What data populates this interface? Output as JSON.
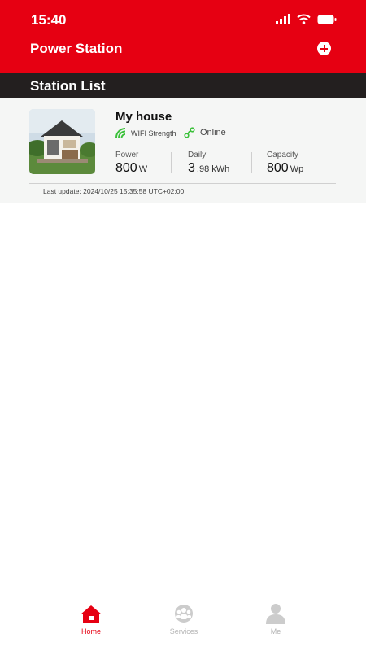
{
  "status_bar": {
    "time": "15:40"
  },
  "header": {
    "title": "Power Station"
  },
  "section": {
    "title": "Station List"
  },
  "station": {
    "name": "My house",
    "wifi_label": "WIFI Strength",
    "status": "Online",
    "power": {
      "label": "Power",
      "value": "800",
      "unit": "W"
    },
    "daily": {
      "label": "Daily",
      "value": "3",
      "unit": ".98 kWh"
    },
    "capacity": {
      "label": "Capacity",
      "value": "800",
      "unit": "Wp"
    },
    "last_update": "Last update: 2024/10/25 15:35:58 UTC+02:00"
  },
  "nav": {
    "home": "Home",
    "services": "Services",
    "me": "Me"
  },
  "colors": {
    "brand": "#e60012",
    "dark_header": "#231f1f",
    "online_green": "#3cc13b"
  }
}
